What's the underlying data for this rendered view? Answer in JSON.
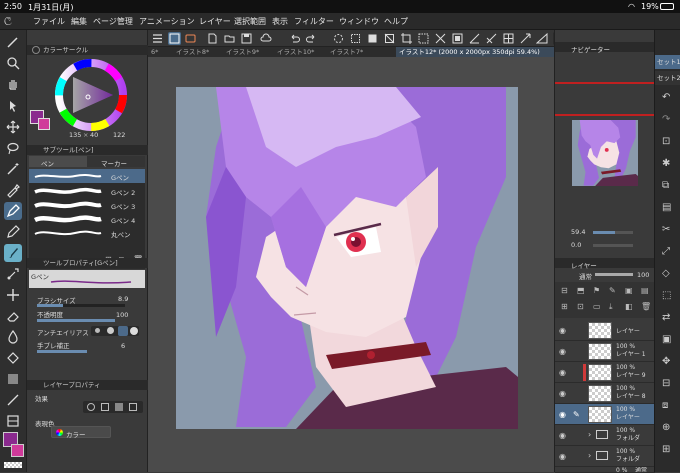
{
  "status": {
    "time": "2:50",
    "date": "1月31日(月)",
    "battery": "19%"
  },
  "menu": [
    "ファイル",
    "編集",
    "ページ管理",
    "アニメーション",
    "レイヤー",
    "選択範囲",
    "表示",
    "フィルター",
    "ウィンドウ",
    "ヘルプ"
  ],
  "tabs": [
    "6*",
    "イラスト8*",
    "イラスト9*",
    "イラスト10*",
    "イラスト7*",
    "イラスト12* (2000 x 2000px 350dpi 59.4%)"
  ],
  "color_circle": {
    "title": "カラーサークル",
    "h": "135",
    "s": "40",
    "v": "122",
    "main_color": "#8a2a8e",
    "sub_color": "#d03a9a"
  },
  "subtool": {
    "title": "サブツール[ペン]",
    "tab_pen": "ペン",
    "tab_marker": "マーカー",
    "brushes": [
      "Gペン",
      "Gペン 2",
      "Gペン 3",
      "Gペン 4",
      "丸ペン"
    ]
  },
  "tool_property": {
    "title": "ツールプロパティ[Gペン]",
    "preset": "Gペン",
    "brush_size_label": "ブラシサイズ",
    "brush_size": "8.9",
    "opacity_label": "不透明度",
    "opacity": "100",
    "antialias_label": "アンチエイリアス",
    "correction_label": "手ブレ補正",
    "correction": "6"
  },
  "layer_property": {
    "title": "レイヤープロパティ",
    "effect_label": "効果",
    "display_color_label": "表現色",
    "display_color": "カラー"
  },
  "navigator": {
    "title": "ナビゲーター",
    "zoom": "59.4",
    "rotation": "0.0"
  },
  "layer_panel": {
    "title": "レイヤー",
    "blend_mode": "通常",
    "opacity": "100",
    "layers": [
      {
        "opacity": "",
        "name": "レイヤー",
        "folder": false,
        "selected": false
      },
      {
        "opacity": "100 %",
        "name": "レイヤー 1",
        "folder": false,
        "selected": false
      },
      {
        "opacity": "100 %",
        "name": "レイヤー 9",
        "folder": false,
        "selected": false
      },
      {
        "opacity": "100 %",
        "name": "レイヤー 8",
        "folder": false,
        "selected": false
      },
      {
        "opacity": "100 %",
        "name": "レイヤー",
        "folder": false,
        "selected": true
      },
      {
        "opacity": "100 %",
        "name": "フォルダ",
        "folder": true,
        "selected": false
      },
      {
        "opacity": "100 %",
        "name": "フォルダ",
        "folder": true,
        "selected": false
      },
      {
        "opacity": "0 %",
        "name": "通常",
        "folder": false,
        "selected": false
      }
    ]
  },
  "right_tabs": [
    "セット1",
    "セット2"
  ]
}
